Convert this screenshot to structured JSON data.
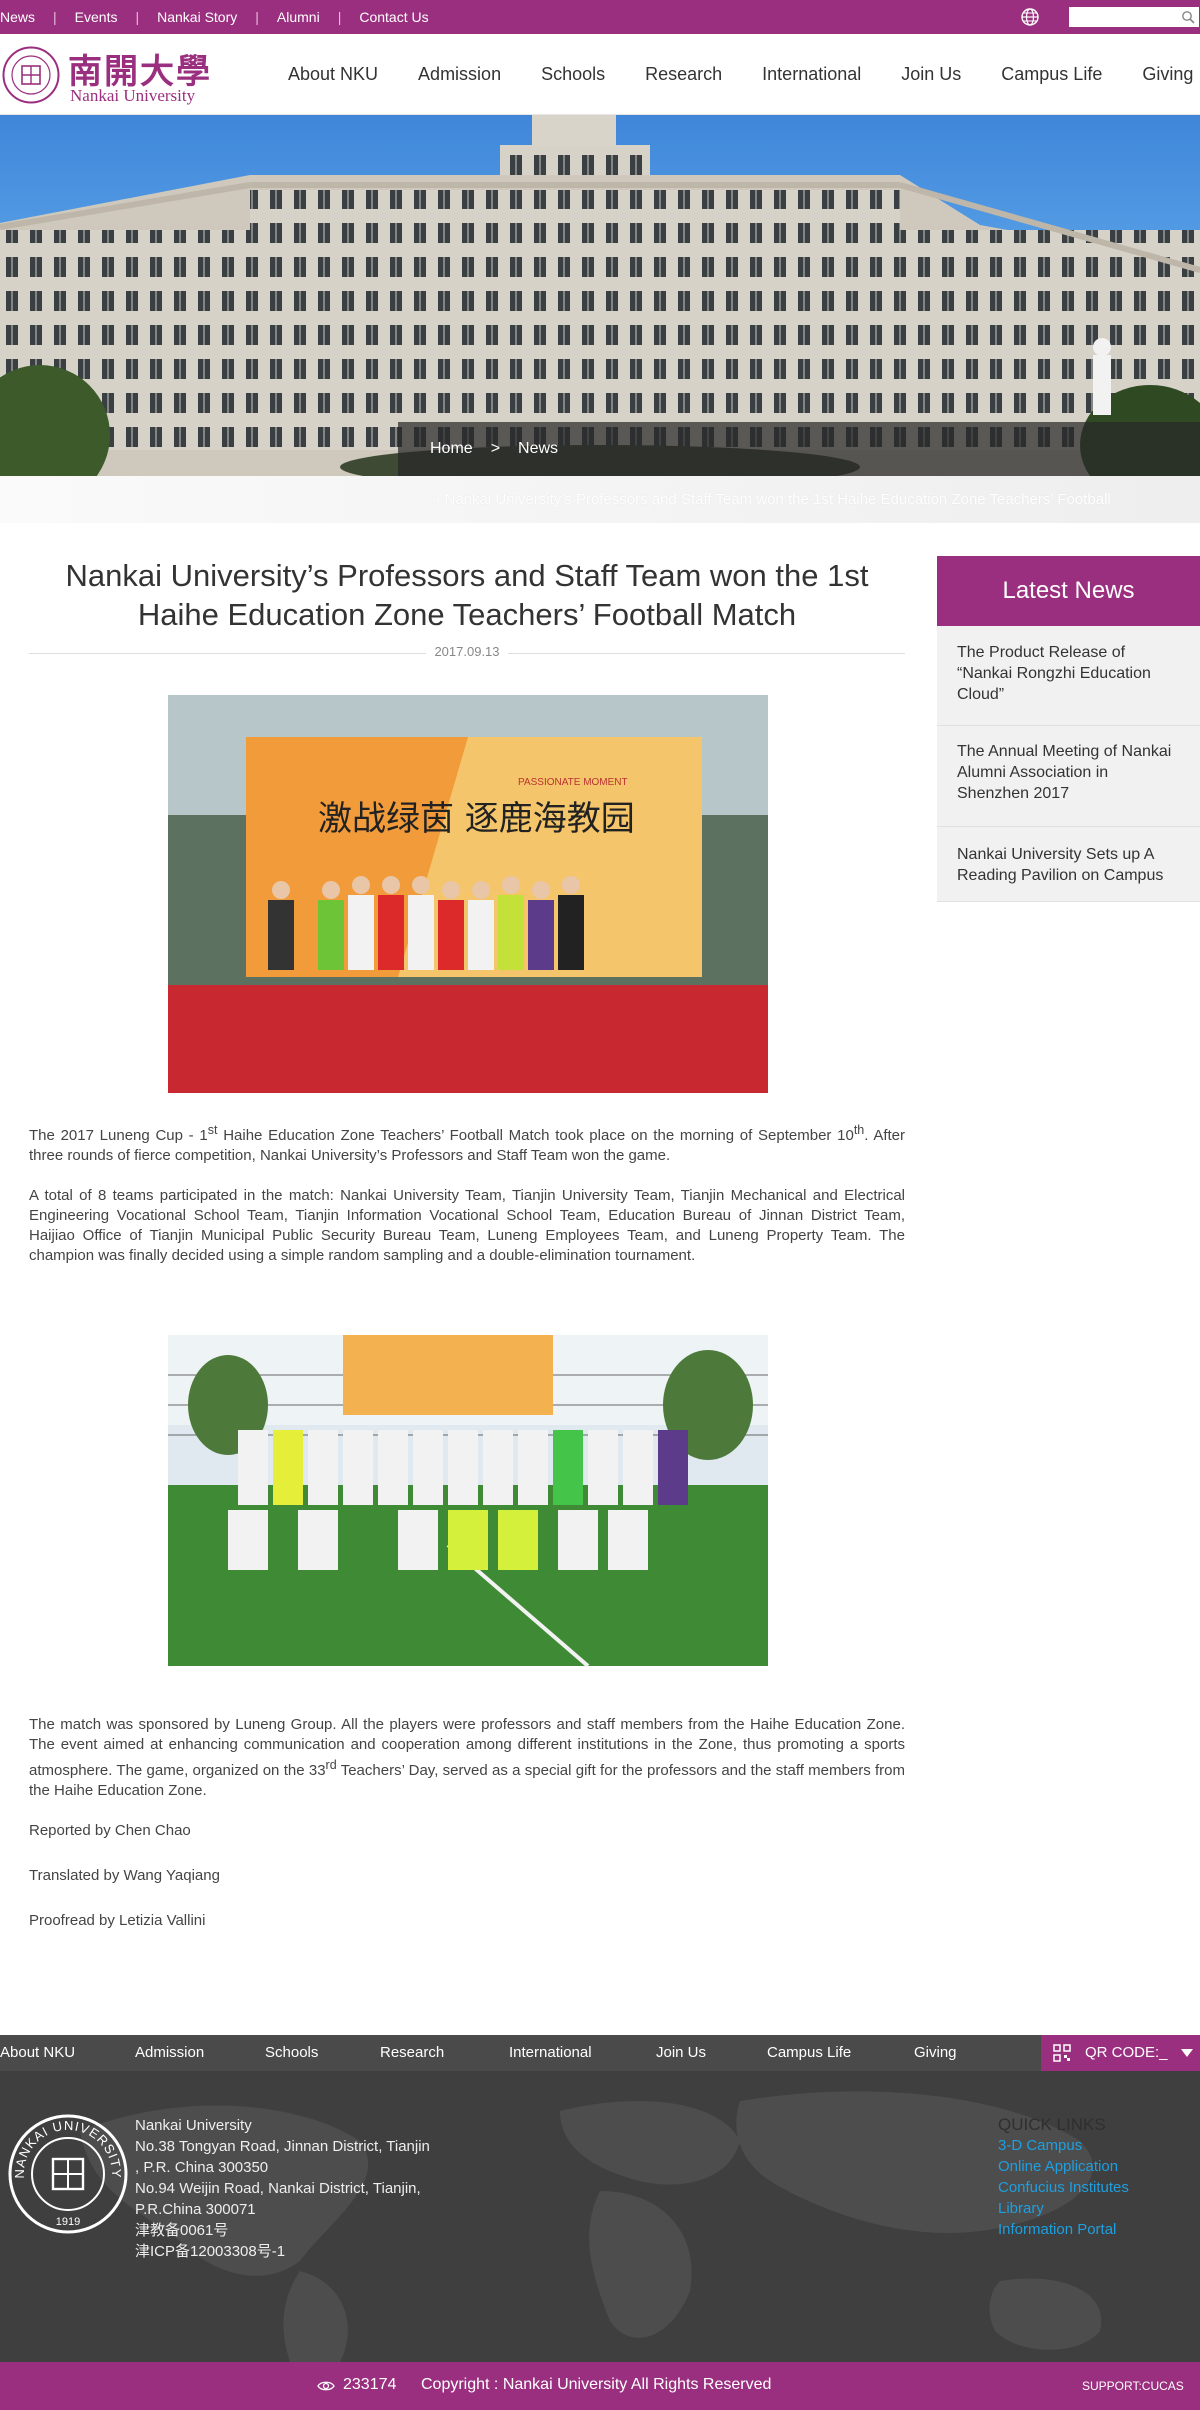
{
  "topbar": {
    "links": [
      "News",
      "Events",
      "Nankai Story",
      "Alumni",
      "Contact Us"
    ],
    "search_placeholder": ""
  },
  "logo": {
    "cn_name": "南開大學",
    "en_name": "Nankai University"
  },
  "nav": {
    "items": [
      "About NKU",
      "Admission",
      "Schools",
      "Research",
      "International",
      "Join Us",
      "Campus Life",
      "Giving"
    ]
  },
  "breadcrumb": {
    "home": "Home",
    "separator": ">",
    "current": "News"
  },
  "ticker": {
    "text": "» Nankai University’s Professors and Staff Team won the 1st Haihe Education Zone Teachers’ Football"
  },
  "article": {
    "title": "Nankai University’s Professors and Staff Team won the 1st Haihe Education Zone Teachers’ Football Match",
    "date": "2017.09.13",
    "p1": {
      "a": "The 2017 Luneng Cup - 1",
      "sup1": "st",
      "b": " Haihe Education Zone Teachers’ Football Match took place on the morning of September 10",
      "sup2": "th",
      "c": ". After three rounds of fierce competition, Nankai University’s Professors and Staff Team won the game."
    },
    "p2": "A total of 8 teams participated in the match: Nankai University Team, Tianjin University Team, Tianjin Mechanical and Electrical Engineering Vocational School Team, Tianjin Information Vocational School Team, Education Bureau of Jinnan District Team, Haijiao Office of Tianjin Municipal Public Security Bureau Team, Luneng Employees Team, and Luneng Property Team. The champion was finally decided using a simple random sampling and a double-elimination tournament.",
    "p3": {
      "a": "The match was sponsored by Luneng Group. All the players were professors and staff members from the Haihe Education Zone. The event aimed at enhancing communication and cooperation among different institutions in the Zone, thus promoting a sports atmosphere. The game, organized on the 33",
      "sup": "rd",
      "b": " Teachers’ Day, served as a special gift for the professors and the staff members from the Haihe Education Zone."
    },
    "reported_by": "Reported by Chen Chao",
    "translated_by": "Translated by Wang Yaqiang",
    "proofread_by": "Proofread by Letizia Vallini",
    "banner_text": "激战绿茵 逐鹿海教园",
    "banner_sub": "PASSIONATE MOMENT"
  },
  "latest_news": {
    "title": "Latest News",
    "items": [
      "The Product Release of “Nankai Rongzhi Education Cloud”",
      "The Annual Meeting of Nankai Alumni Association in Shenzhen 2017",
      "Nankai University Sets up A Reading Pavilion on Campus"
    ]
  },
  "footer": {
    "nav": [
      "About NKU",
      "Admission",
      "Schools",
      "Research",
      "International",
      "Join Us",
      "Campus Life",
      "Giving"
    ],
    "qr_label": "QR CODE:_",
    "address_lines": [
      "Nankai University",
      "No.38 Tongyan Road, Jinnan District, Tianjin",
      ", P.R. China 300350",
      "No.94 Weijin Road,  Nankai District, Tianjin,",
      "P.R.China  300071",
      "津教备0061号",
      "津ICP备12003308号-1"
    ],
    "quick_links_title": "QUICK LINKS",
    "quick_links": [
      "3-D Campus",
      "Online Application",
      "Confucius Institutes",
      "Library",
      "Information Portal"
    ],
    "visit_count": "233174",
    "copyright": "Copyright : Nankai University All Rights Reserved",
    "support": "SUPPORT:CUCAS",
    "seal_text": "NANKAI UNIVERSITY",
    "seal_year": "1919"
  },
  "colors": {
    "brand": "#9b2f7f",
    "footer_dark": "#3f3f3f",
    "link_blue": "#1e9fdf"
  }
}
